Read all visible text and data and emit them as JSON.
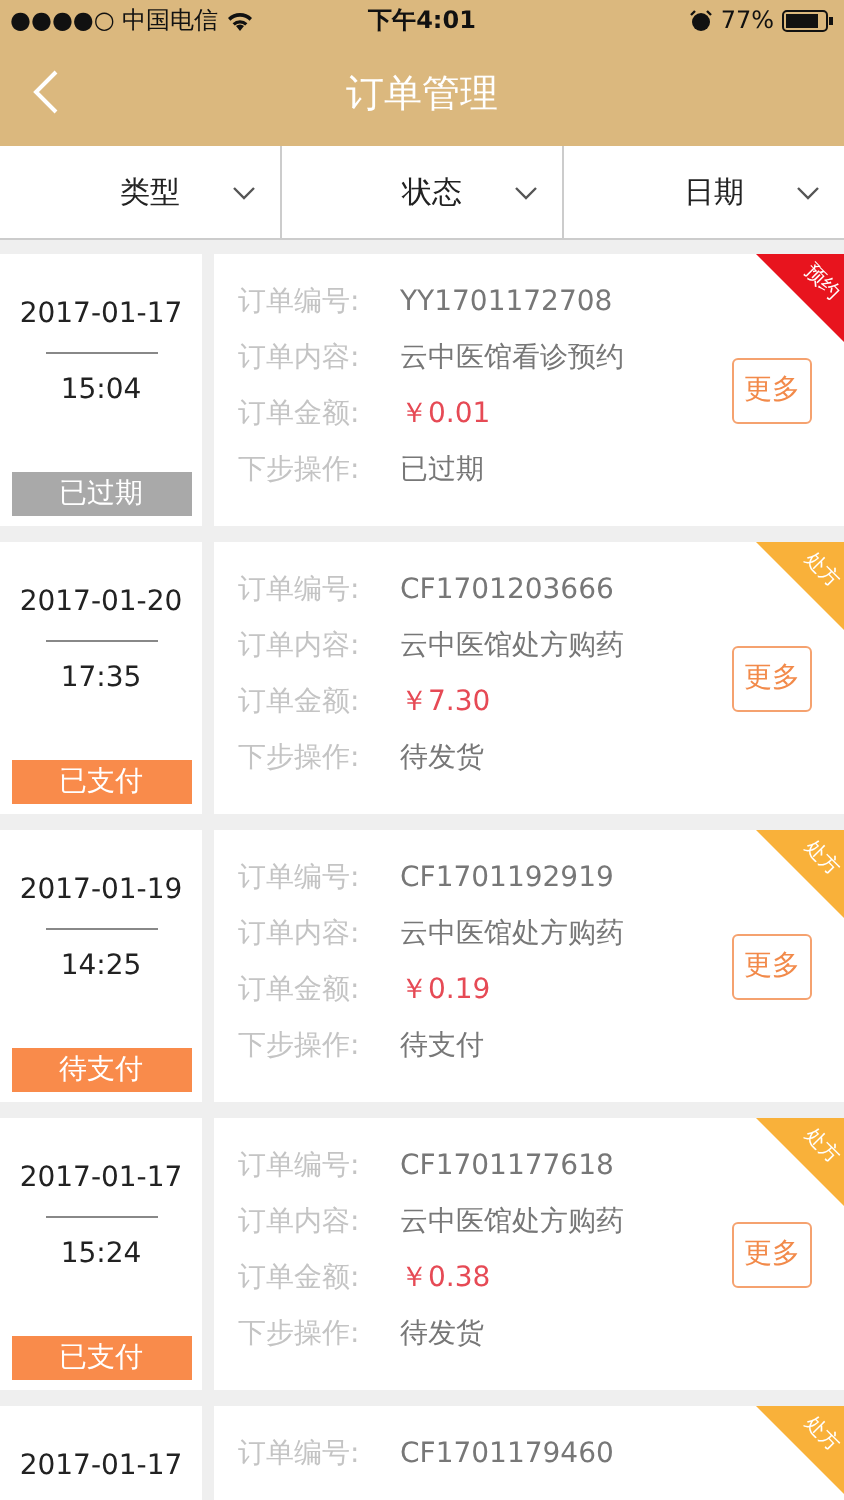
{
  "status_bar": {
    "carrier": "●●●●○ 中国电信",
    "time": "下午4:01",
    "battery": "77%"
  },
  "nav": {
    "title": "订单管理"
  },
  "filters": [
    {
      "label": "类型"
    },
    {
      "label": "状态"
    },
    {
      "label": "日期"
    }
  ],
  "orders": [
    {
      "date": "2017-01-17",
      "time": "15:04",
      "status": {
        "label": "已过期",
        "kind": "expired"
      },
      "badge": {
        "label": "预约",
        "color": "#e8141e"
      },
      "fields": [
        {
          "label": "订单编号:",
          "value": "YY1701172708",
          "kind": "plain"
        },
        {
          "label": "订单内容:",
          "value": "云中医馆看诊预约",
          "kind": "plain"
        },
        {
          "label": "订单金额:",
          "value": "￥0.01",
          "kind": "price"
        },
        {
          "label": "下步操作:",
          "value": "已过期",
          "kind": "plain"
        }
      ],
      "more": "更多"
    },
    {
      "date": "2017-01-20",
      "time": "17:35",
      "status": {
        "label": "已支付",
        "kind": "active"
      },
      "badge": {
        "label": "处方",
        "color": "#f9b13a"
      },
      "fields": [
        {
          "label": "订单编号:",
          "value": "CF1701203666",
          "kind": "plain"
        },
        {
          "label": "订单内容:",
          "value": "云中医馆处方购药",
          "kind": "plain"
        },
        {
          "label": "订单金额:",
          "value": "￥7.30",
          "kind": "price"
        },
        {
          "label": "下步操作:",
          "value": "待发货",
          "kind": "plain"
        }
      ],
      "more": "更多"
    },
    {
      "date": "2017-01-19",
      "time": "14:25",
      "status": {
        "label": "待支付",
        "kind": "active"
      },
      "badge": {
        "label": "处方",
        "color": "#f9b13a"
      },
      "fields": [
        {
          "label": "订单编号:",
          "value": "CF1701192919",
          "kind": "plain"
        },
        {
          "label": "订单内容:",
          "value": "云中医馆处方购药",
          "kind": "plain"
        },
        {
          "label": "订单金额:",
          "value": "￥0.19",
          "kind": "price"
        },
        {
          "label": "下步操作:",
          "value": "待支付",
          "kind": "plain"
        }
      ],
      "more": "更多"
    },
    {
      "date": "2017-01-17",
      "time": "15:24",
      "status": {
        "label": "已支付",
        "kind": "active"
      },
      "badge": {
        "label": "处方",
        "color": "#f9b13a"
      },
      "fields": [
        {
          "label": "订单编号:",
          "value": "CF1701177618",
          "kind": "plain"
        },
        {
          "label": "订单内容:",
          "value": "云中医馆处方购药",
          "kind": "plain"
        },
        {
          "label": "订单金额:",
          "value": "￥0.38",
          "kind": "price"
        },
        {
          "label": "下步操作:",
          "value": "待发货",
          "kind": "plain"
        }
      ],
      "more": "更多"
    },
    {
      "date": "2017-01-17",
      "badge": {
        "label": "处方",
        "color": "#f9b13a"
      },
      "fields": [
        {
          "label": "订单编号:",
          "value": "CF1701179460",
          "kind": "plain"
        }
      ]
    }
  ]
}
